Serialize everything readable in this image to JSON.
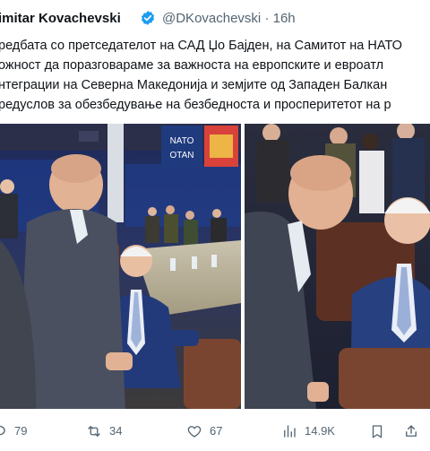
{
  "tweet": {
    "author_name": "imitar Kovachevski",
    "handle": "@DKovachevski",
    "separator": "·",
    "time": "16h",
    "text_lines": [
      "редбата со претседателот на САД Џо Бајден, на Самитот на НАТО",
      "ожност да поразговараме за важноста на европските и евроатл",
      "нтеграции на Северна Македонија и земјите од Западен Балкан",
      "редуслов за обезбедување на безбедноста и просперитетот на р"
    ],
    "sign_lines": [
      "NATO",
      "OTAN"
    ]
  },
  "actions": {
    "replies": "79",
    "reposts": "34",
    "likes": "67",
    "views": "14.9K"
  },
  "icons": {
    "verified": "verified-badge-icon",
    "reply": "reply-icon",
    "repost": "repost-icon",
    "like": "heart-icon",
    "views": "analytics-icon",
    "bookmark": "bookmark-icon",
    "share": "share-icon"
  },
  "colors": {
    "verified": "#1d9bf0",
    "muted": "#536471",
    "text": "#0f1419"
  }
}
